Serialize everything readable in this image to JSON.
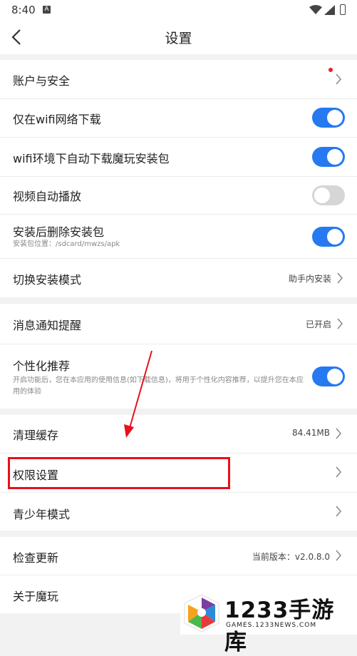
{
  "status_bar": {
    "time": "8:40",
    "notif_icon": "A"
  },
  "header": {
    "title": "设置"
  },
  "items": {
    "account": {
      "label": "账户与安全"
    },
    "wifi_only": {
      "label": "仅在wifi网络下载",
      "toggle": "on"
    },
    "auto_download": {
      "label": "wifi环境下自动下载魔玩安装包",
      "toggle": "on"
    },
    "autoplay": {
      "label": "视频自动播放",
      "toggle": "off"
    },
    "delete_after": {
      "label": "安装后删除安装包",
      "sub": "安装包位置：/sdcard/mwzs/apk",
      "toggle": "on"
    },
    "install_mode": {
      "label": "切换安装模式",
      "value": "助手内安装"
    },
    "notify": {
      "label": "消息通知提醒",
      "value": "已开启"
    },
    "personal": {
      "label": "个性化推荐",
      "sub": "开启功能后，您在本应用的使用信息(如下载信息)，将用于个性化内容推荐，以提升您在本应用的体验",
      "toggle": "on"
    },
    "cache": {
      "label": "清理缓存",
      "value": "84.41MB"
    },
    "permission": {
      "label": "权限设置"
    },
    "youth": {
      "label": "青少年模式"
    },
    "update": {
      "label": "检查更新",
      "value": "当前版本：v2.0.8.0"
    },
    "about": {
      "label": "关于魔玩"
    }
  },
  "watermark": {
    "brand": "1233手游库",
    "url": "GAMES.1233NEWS.COM"
  },
  "colors": {
    "accent": "#2679f0",
    "highlight": "#e8101c",
    "arrow": "#e8101c",
    "badge": "#e8202a"
  }
}
